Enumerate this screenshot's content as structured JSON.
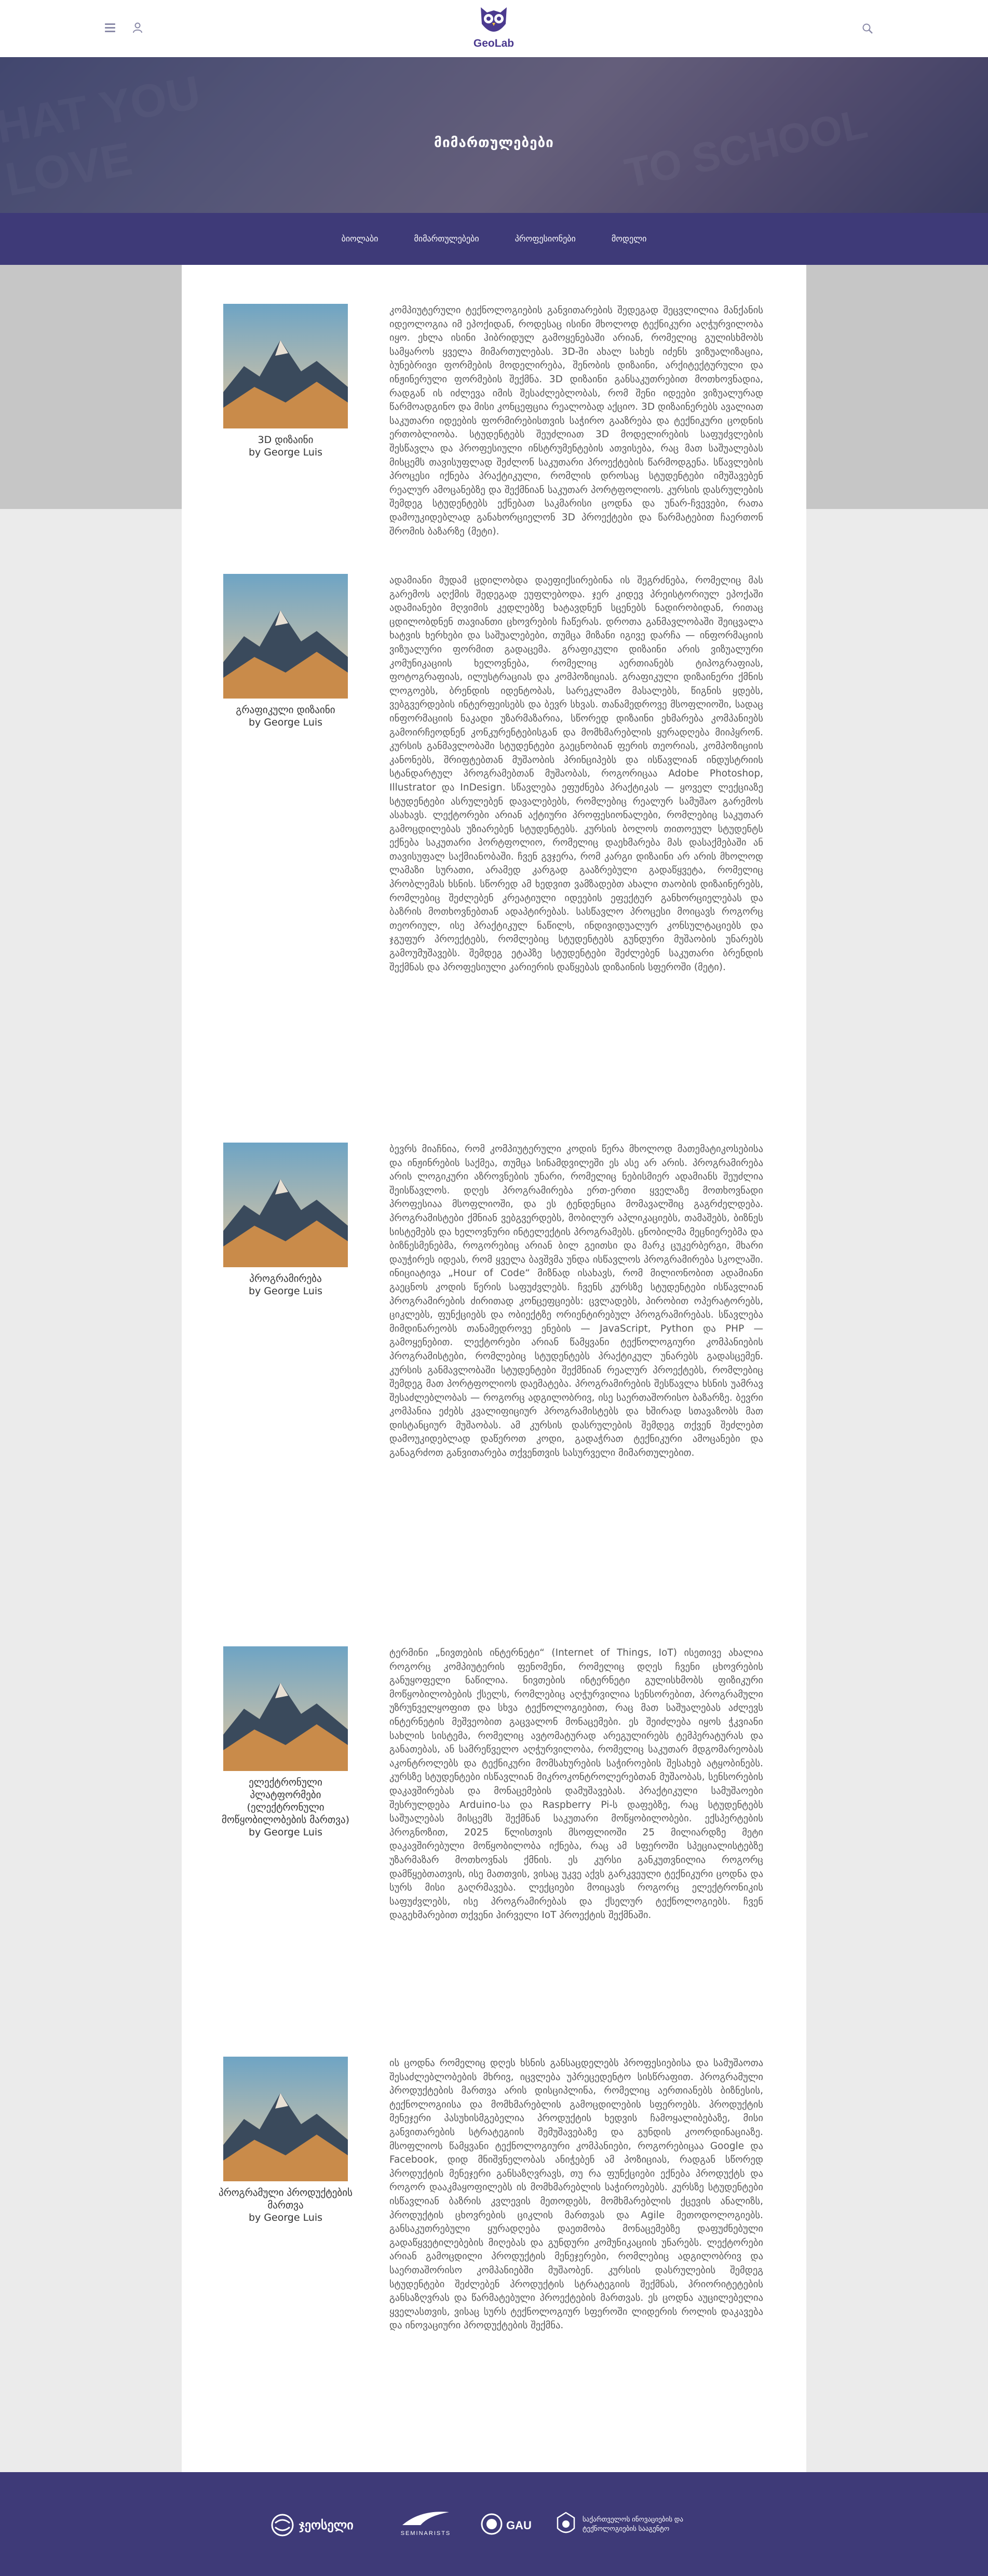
{
  "brand": {
    "logo_text": "GeoLab",
    "accent": "#3e3a78",
    "logo_color": "#4b3a8f"
  },
  "header": {
    "icons": [
      "menu-icon",
      "user-icon",
      "search-icon"
    ]
  },
  "hero": {
    "title": "მიმართულებები"
  },
  "nav": {
    "items": [
      "ბიოლაბი",
      "მიმართულებები",
      "პროფესიონები",
      "მოდელი"
    ]
  },
  "entries": [
    {
      "caption": "3D დიზაინი\nby George Luis",
      "text": "კომპიუტერული ტექნოლოგიების განვითარების შედეგად შეცვლილია მანქანის იდეოლოგია იმ ეპოქიდან, როდესაც ისინი მხოლოდ ტექნიკური აღჭურვილობა იყო. ეხლა ისინი ჰიბრიდულ გამოყენებაში არიან, რომელიც გულისხმობს სამყაროს ყველა მიმართულებას. 3D-ში ახალ სახეს იძენს ვიზუალიზაცია, ბუნებრივი ფორმების მოდელირება, შენობის დიზაინი, არქიტექტურული და ინჟინერული ფორმების შექმნა. 3D დიზაინი განსაკუთრებით მოთხოვნადია, რადგან ის იძლევა იმის შესაძლებლობას, რომ შენი იდეები ვიზუალურად წარმოადგინო და მისი კონცეფცია რეალობად აქციო. 3D დიზაინერებს ავალიათ საკუთარი იდეების ფორმირებისთვის საჭირო გააზრება და ტექნიკური ცოდნის ერთობლიობა. სტუდენტებს შეუძლიათ 3D მოდელირების საფუძვლების შესწავლა და პროფესიული ინსტრუმენტების ათვისება, რაც მათ საშუალებას მისცემს თავისუფლად შეძლონ საკუთარი პროექტების წარმოდგენა. სწავლების პროცესი იქნება პრაქტიკული, რომლის დროსაც სტუდენტები იმუშავებენ რეალურ ამოცანებზე და შექმნიან საკუთარ პორტფოლიოს. კურსის დასრულების შემდეგ სტუდენტებს ექნებათ საკმარისი ცოდნა და უნარ-ჩვევები, რათა დამოუკიდებლად განახორციელონ 3D პროექტები და წარმატებით ჩაერთონ შრომის ბაზარზე (მეტი)."
    },
    {
      "caption": "გრაფიკული დიზაინი\nby George Luis",
      "text": "ადამიანი მუდამ ცდილობდა დაეფიქსირებინა ის შეგრძნება, რომელიც მას გარემოს აღქმის შედეგად ეუფლებოდა. ჯერ კიდევ პრეისტორიულ ეპოქაში ადამიანები მღვიმის კედლებზე ხატავდნენ სცენებს ნადირობიდან, რითაც ცდილობდნენ თავიანთი ცხოვრების ჩაწერას. დროთა განმავლობაში შეიცვალა ხატვის ხერხები და საშუალებები, თუმცა მიზანი იგივე დარჩა — ინფორმაციის ვიზუალური ფორმით გადაცემა. გრაფიკული დიზაინი არის ვიზუალური კომუნიკაციის ხელოვნება, რომელიც აერთიანებს ტიპოგრაფიას, ფოტოგრაფიას, ილუსტრაციას და კომპოზიციას. გრაფიკული დიზაინერი ქმნის ლოგოებს, ბრენდის იდენტობას, სარეკლამო მასალებს, წიგნის ყდებს, ვებგვერდების ინტერფეისებს და ბევრ სხვას. თანამედროვე მსოფლიოში, სადაც ინფორმაციის ნაკადი უზარმაზარია, სწორედ დიზაინი ეხმარება კომპანიებს გამოირჩეოდნენ კონკურენტებისგან და მომხმარებლის ყურადღება მიიპყრონ. კურსის განმავლობაში სტუდენტები გაეცნობიან ფერის თეორიას, კომპოზიციის კანონებს, შრიფტებთან მუშაობის პრინციპებს და ისწავლიან ინდუსტრიის სტანდარტულ პროგრამებთან მუშაობას, როგორიცაა Adobe Photoshop, Illustrator და InDesign. სწავლება ეფუძნება პრაქტიკას — ყოველ ლექციაზე სტუდენტები ასრულებენ დავალებებს, რომლებიც რეალურ სამუშაო გარემოს ასახავს. ლექტორები არიან აქტიური პროფესიონალები, რომლებიც საკუთარ გამოცდილებას უზიარებენ სტუდენტებს. კურსის ბოლოს თითოეულ სტუდენტს ექნება საკუთარი პორტფოლიო, რომელიც დაეხმარება მას დასაქმებაში ან თავისუფალ საქმიანობაში. ჩვენ გვჯერა, რომ კარგი დიზაინი არ არის მხოლოდ ლამაზი სურათი, არამედ კარგად გააზრებული გადაწყვეტა, რომელიც პრობლემას ხსნის. სწორედ ამ ხედვით ვამზადებთ ახალი თაობის დიზაინერებს, რომლებიც შეძლებენ კრეატიული იდეების ეფექტურ განხორციელებას და ბაზრის მოთხოვნებთან ადაპტირებას. სასწავლო პროცესი მოიცავს როგორც თეორიულ, ისე პრაქტიკულ ნაწილს, ინდივიდუალურ კონსულტაციებს და ჯგუფურ პროექტებს, რომლებიც სტუდენტებს გუნდური მუშაობის უნარებს გამოუმუშავებს. შემდეგ ეტაპზე სტუდენტები შეძლებენ საკუთარი ბრენდის შექმნას და პროფესიული კარიერის დაწყებას დიზაინის სფეროში (მეტი)."
    },
    {
      "caption": "პროგრამირება\nby George Luis",
      "text": "ბევრს მიაჩნია, რომ კომპიუტერული კოდის წერა მხოლოდ მათემატიკოსებისა და ინჟინრების საქმეა, თუმცა სინამდვილეში ეს ასე არ არის. პროგრამირება არის ლოგიკური აზროვნების უნარი, რომელიც ნებისმიერ ადამიანს შეუძლია შეისწავლოს. დღეს პროგრამირება ერთ-ერთი ყველაზე მოთხოვნადი პროფესიაა მსოფლიოში, და ეს ტენდენცია მომავალშიც გაგრძელდება. პროგრამისტები ქმნიან ვებგვერდებს, მობილურ აპლიკაციებს, თამაშებს, ბიზნეს სისტემებს და ხელოვნური ინტელექტის პროგრამებს. ცნობილმა მეცნიერებმა და ბიზნესმენებმა, როგორებიც არიან ბილ გეითსი და მარკ ცუკერბერგი, მხარი დაუჭირეს იდეას, რომ ყველა ბავშვმა უნდა ისწავლოს პროგრამირება სკოლაში. ინიციატივა „Hour of Code“ მიზნად ისახავს, რომ მილიონობით ადამიანი გაეცნოს კოდის წერის საფუძვლებს. ჩვენს კურსზე სტუდენტები ისწავლიან პროგრამირების ძირითად კონცეფციებს: ცვლადებს, პირობით ოპერატორებს, ციკლებს, ფუნქციებს და ობიექტზე ორიენტირებულ პროგრამირებას. სწავლება მიმდინარეობს თანამედროვე ენების — JavaScript, Python და PHP — გამოყენებით. ლექტორები არიან წამყვანი ტექნოლოგიური კომპანიების პროგრამისტები, რომლებიც სტუდენტებს პრაქტიკულ უნარებს გადასცემენ. კურსის განმავლობაში სტუდენტები შექმნიან რეალურ პროექტებს, რომლებიც შემდეგ მათ პორტფოლიოს დაემატება. პროგრამირების შესწავლა ხსნის უამრავ შესაძლებლობას — როგორც ადგილობრივ, ისე საერთაშორისო ბაზარზე. ბევრი კომპანია ეძებს კვალიფიციურ პროგრამისტებს და ხშირად სთავაზობს მათ დისტანციურ მუშაობას. ამ კურსის დასრულების შემდეგ თქვენ შეძლებთ დამოუკიდებლად დაწეროთ კოდი, გადაჭრათ ტექნიკური ამოცანები და განაგრძოთ განვითარება თქვენთვის სასურველი მიმართულებით."
    },
    {
      "caption": "ელექტრონული პლატფორმები (ელექტრონული მოწყობილობების მართვა)\nby George Luis",
      "text": "ტერმინი „ნივთების ინტერნეტი“ (Internet of Things, IoT) ისეთივე ახალია როგორც კომპიუტერის ფენომენი, რომელიც დღეს ჩვენი ცხოვრების განუყოფელი ნაწილია. ნივთების ინტერნეტი გულისხმობს ფიზიკური მოწყობილობების ქსელს, რომლებიც აღჭურვილია სენსორებით, პროგრამული უზრუნველყოფით და სხვა ტექნოლოგიებით, რაც მათ საშუალებას აძლევს ინტერნეტის მეშვეობით გაცვალონ მონაცემები. ეს შეიძლება იყოს ჭკვიანი სახლის სისტემა, რომელიც ავტომატურად არეგულირებს ტემპერატურას და განათებას, ან სამრეწველო აღჭურვილობა, რომელიც საკუთარ მდგომარეობას აკონტროლებს და ტექნიკური მომსახურების საჭიროების შესახებ ატყობინებს. კურსზე სტუდენტები ისწავლიან მიკროკონტროლერებთან მუშაობას, სენსორების დაკავშირებას და მონაცემების დამუშავებას. პრაქტიკული სამუშაოები შესრულდება Arduino-სა და Raspberry Pi-ს დაფებზე, რაც სტუდენტებს საშუალებას მისცემს შექმნან საკუთარი მოწყობილობები. ექსპერტების პროგნოზით, 2025 წლისთვის მსოფლიოში 25 მილიარდზე მეტი დაკავშირებული მოწყობილობა იქნება, რაც ამ სფეროში სპეციალისტებზე უზარმაზარ მოთხოვნას ქმნის. ეს კურსი განკუთვნილია როგორც დამწყებთათვის, ისე მათთვის, ვისაც უკვე აქვს გარკვეული ტექნიკური ცოდნა და სურს მისი გაღრმავება. ლექციები მოიცავს როგორც ელექტრონიკის საფუძვლებს, ისე პროგრამირებას და ქსელურ ტექნოლოგიებს. ჩვენ დაგეხმარებით თქვენი პირველი IoT პროექტის შექმნაში."
    },
    {
      "caption": "პროგრამული პროდუქტების მართვა\nby George Luis",
      "text": "ის ცოდნა რომელიც დღეს ხსნის განსაცდელებს პროფესიებისა და სამუშაოთა შესაძლებლობების მხრივ, იცვლება უპრეცედენტო სისწრაფით. პროგრამული პროდუქტების მართვა არის დისციპლინა, რომელიც აერთიანებს ბიზნესის, ტექნოლოგიისა და მომხმარებლის გამოცდილების სფეროებს. პროდუქტის მენეჯერი პასუხისმგებელია პროდუქტის ხედვის ჩამოყალიბებაზე, მისი განვითარების სტრატეგიის შემუშავებაზე და გუნდის კოორდინაციაზე. მსოფლიოს წამყვანი ტექნოლოგიური კომპანიები, როგორებიცაა Google და Facebook, დიდ მნიშვნელობას ანიჭებენ ამ პოზიციას, რადგან სწორედ პროდუქტის მენეჯერი განსაზღვრავს, თუ რა ფუნქციები ექნება პროდუქტს და როგორ დააკმაყოფილებს ის მომხმარებლის საჭიროებებს. კურსზე სტუდენტები ისწავლიან ბაზრის კვლევის მეთოდებს, მომხმარებლის ქცევის ანალიზს, პროდუქტის ცხოვრების ციკლის მართვას და Agile მეთოდოლოგიებს. განსაკუთრებული ყურადღება დაეთმობა მონაცემებზე დაფუძნებული გადაწყვეტილებების მიღებას და გუნდური კომუნიკაციის უნარებს. ლექტორები არიან გამოცდილი პროდუქტის მენეჯერები, რომლებიც ადგილობრივ და საერთაშორისო კომპანიებში მუშაობენ. კურსის დასრულების შემდეგ სტუდენტები შეძლებენ პროდუქტის სტრატეგიის შექმნას, პრიორიტეტების განსაზღვრას და წარმატებული პროექტების მართვას. ეს ცოდნა აუცილებელია ყველასთვის, ვისაც სურს ტექნოლოგიურ სფეროში ლიდერის როლის დაკავება და ინოვაციური პროდუქტების შექმნა."
    }
  ],
  "footer": {
    "partners": [
      "ჯეოსელი",
      "SEMINARISTS",
      "GAU",
      "საქართველოს ინოვაციების და ტექნოლოგიების სააგენტო"
    ]
  }
}
